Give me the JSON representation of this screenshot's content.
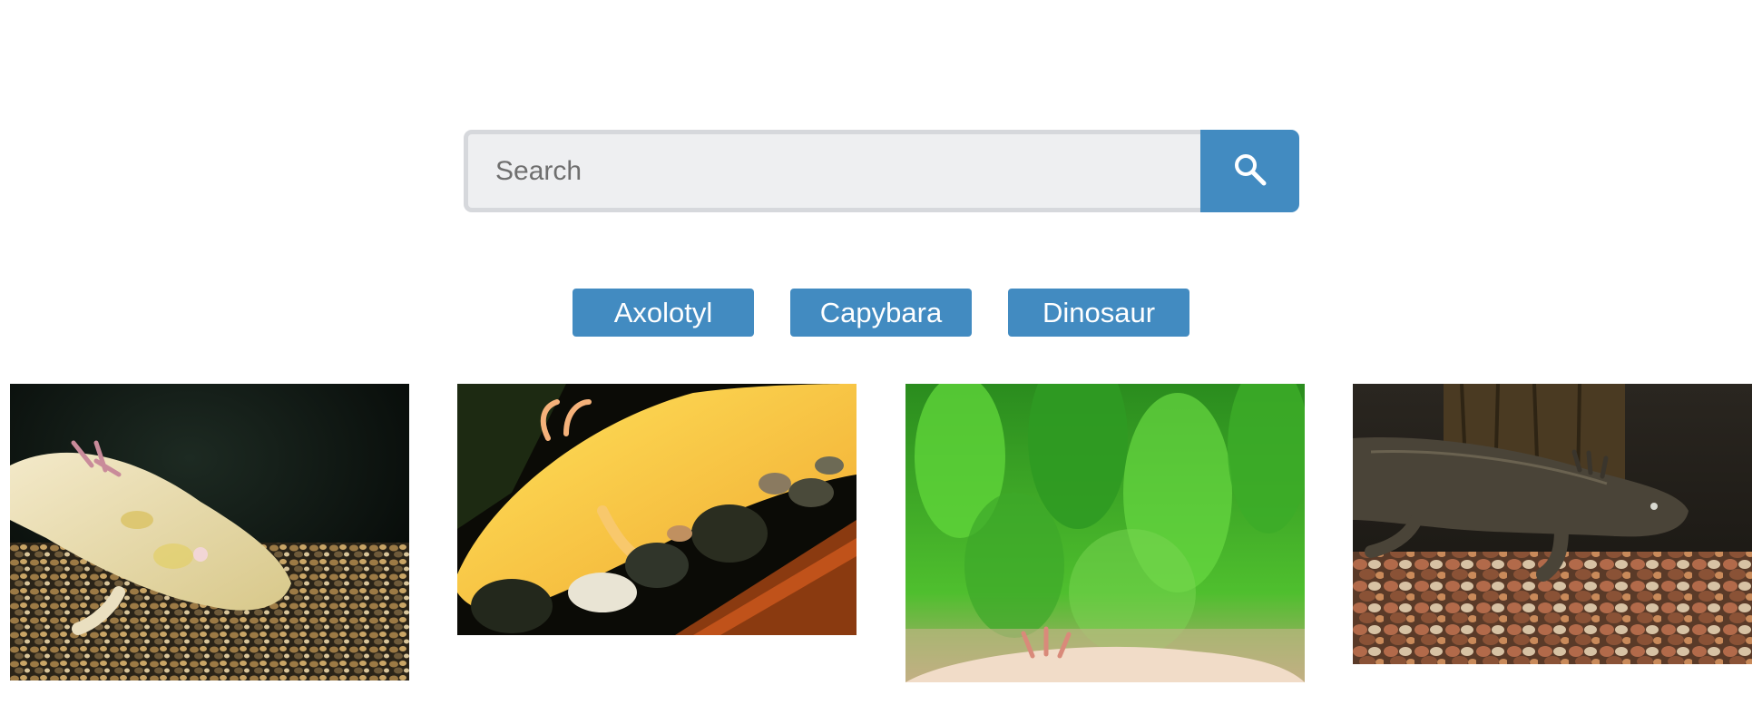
{
  "search": {
    "placeholder": "Search",
    "value": "",
    "icon": "search-icon",
    "accent_color": "#428bc1"
  },
  "categories": [
    {
      "label": "Axolotyl"
    },
    {
      "label": "Capybara"
    },
    {
      "label": "Dinosaur"
    }
  ],
  "gallery": {
    "images": [
      {
        "subject": "pale yellow axolotl on gravel"
      },
      {
        "subject": "golden axolotl on pebbles"
      },
      {
        "subject": "axolotl beneath green aquarium plants"
      },
      {
        "subject": "dark brown axolotl on pebbles"
      }
    ]
  }
}
